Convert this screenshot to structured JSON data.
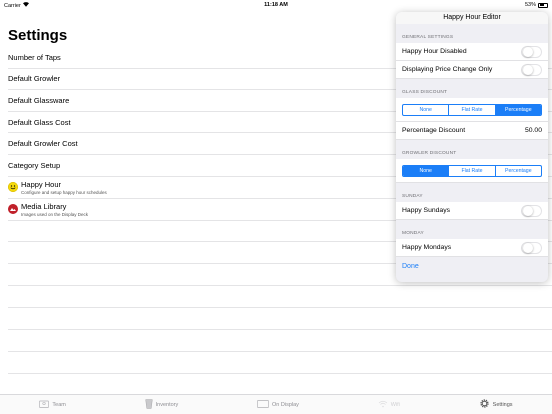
{
  "status_bar": {
    "carrier": "Carrier",
    "time": "11:18 AM",
    "battery": "53%",
    "battery_level": 0.53
  },
  "page": {
    "title": "Settings",
    "rows": [
      {
        "label": "Number of Taps"
      },
      {
        "label": "Default Growler"
      },
      {
        "label": "Default Glassware"
      },
      {
        "label": "Default Glass Cost"
      },
      {
        "label": "Default Growler Cost"
      },
      {
        "label": "Category Setup"
      },
      {
        "label": "Happy Hour",
        "subtitle": "Configure and setup happy hour schedules",
        "icon": "smiley-icon"
      },
      {
        "label": "Media Library",
        "subtitle": "Images used on the Display Deck",
        "icon": "media-library-icon"
      }
    ]
  },
  "tabs": [
    {
      "label": "Team",
      "icon": "team-icon",
      "state": "normal"
    },
    {
      "label": "Inventory",
      "icon": "glass-icon",
      "state": "normal"
    },
    {
      "label": "On Display",
      "icon": "display-icon",
      "state": "normal"
    },
    {
      "label": "Wifi",
      "icon": "wifi-icon",
      "state": "disabled"
    },
    {
      "label": "Settings",
      "icon": "gear-icon",
      "state": "active"
    }
  ],
  "popover": {
    "title": "Happy Hour Editor",
    "general": {
      "header": "GENERAL SETTINGS",
      "happy_hour_disabled": "Happy Hour Disabled",
      "displaying_price_change": "Displaying Price Change Only"
    },
    "glass_discount": {
      "header": "GLASS DISCOUNT",
      "options": [
        "None",
        "Flat Rate",
        "Percentage"
      ],
      "selected": "Percentage",
      "field_label": "Percentage Discount",
      "field_value": "50.00"
    },
    "growler_discount": {
      "header": "GROWLER DISCOUNT",
      "options": [
        "None",
        "Flat Rate",
        "Percentage"
      ],
      "selected": "None"
    },
    "sunday": {
      "header": "SUNDAY",
      "label": "Happy Sundays"
    },
    "monday": {
      "header": "MONDAY",
      "label": "Happy Mondays"
    },
    "done": "Done"
  },
  "colors": {
    "accent": "#1b7ef7"
  }
}
